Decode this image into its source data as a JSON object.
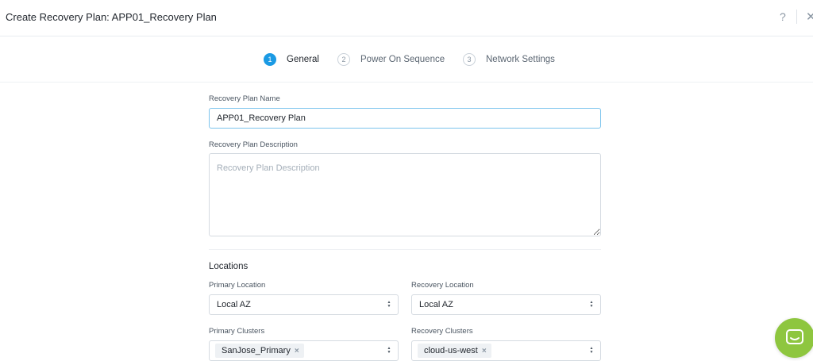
{
  "header": {
    "title": "Create Recovery Plan: APP01_Recovery Plan",
    "help_label": "?",
    "close_label": "✕"
  },
  "steps": [
    {
      "number": "1",
      "label": "General",
      "active": true
    },
    {
      "number": "2",
      "label": "Power On Sequence",
      "active": false
    },
    {
      "number": "3",
      "label": "Network Settings",
      "active": false
    }
  ],
  "form": {
    "name": {
      "label": "Recovery Plan Name",
      "value": "APP01_Recovery Plan"
    },
    "description": {
      "label": "Recovery Plan Description",
      "placeholder": "Recovery Plan Description",
      "value": ""
    },
    "locations_title": "Locations",
    "primary_location": {
      "label": "Primary Location",
      "value": "Local AZ"
    },
    "recovery_location": {
      "label": "Recovery Location",
      "value": "Local AZ"
    },
    "primary_clusters": {
      "label": "Primary Clusters",
      "tags": [
        "SanJose_Primary"
      ]
    },
    "recovery_clusters": {
      "label": "Recovery Clusters",
      "tags": [
        "cloud-us-west"
      ]
    }
  },
  "colors": {
    "accent": "#1b9ae4",
    "chat_button": "#8ec63f"
  },
  "icons": {
    "help": "question-mark-icon",
    "close": "close-icon",
    "select_caret": "up-down-caret-icon",
    "tag_remove": "x-icon",
    "chat": "chat-bubble-icon"
  }
}
